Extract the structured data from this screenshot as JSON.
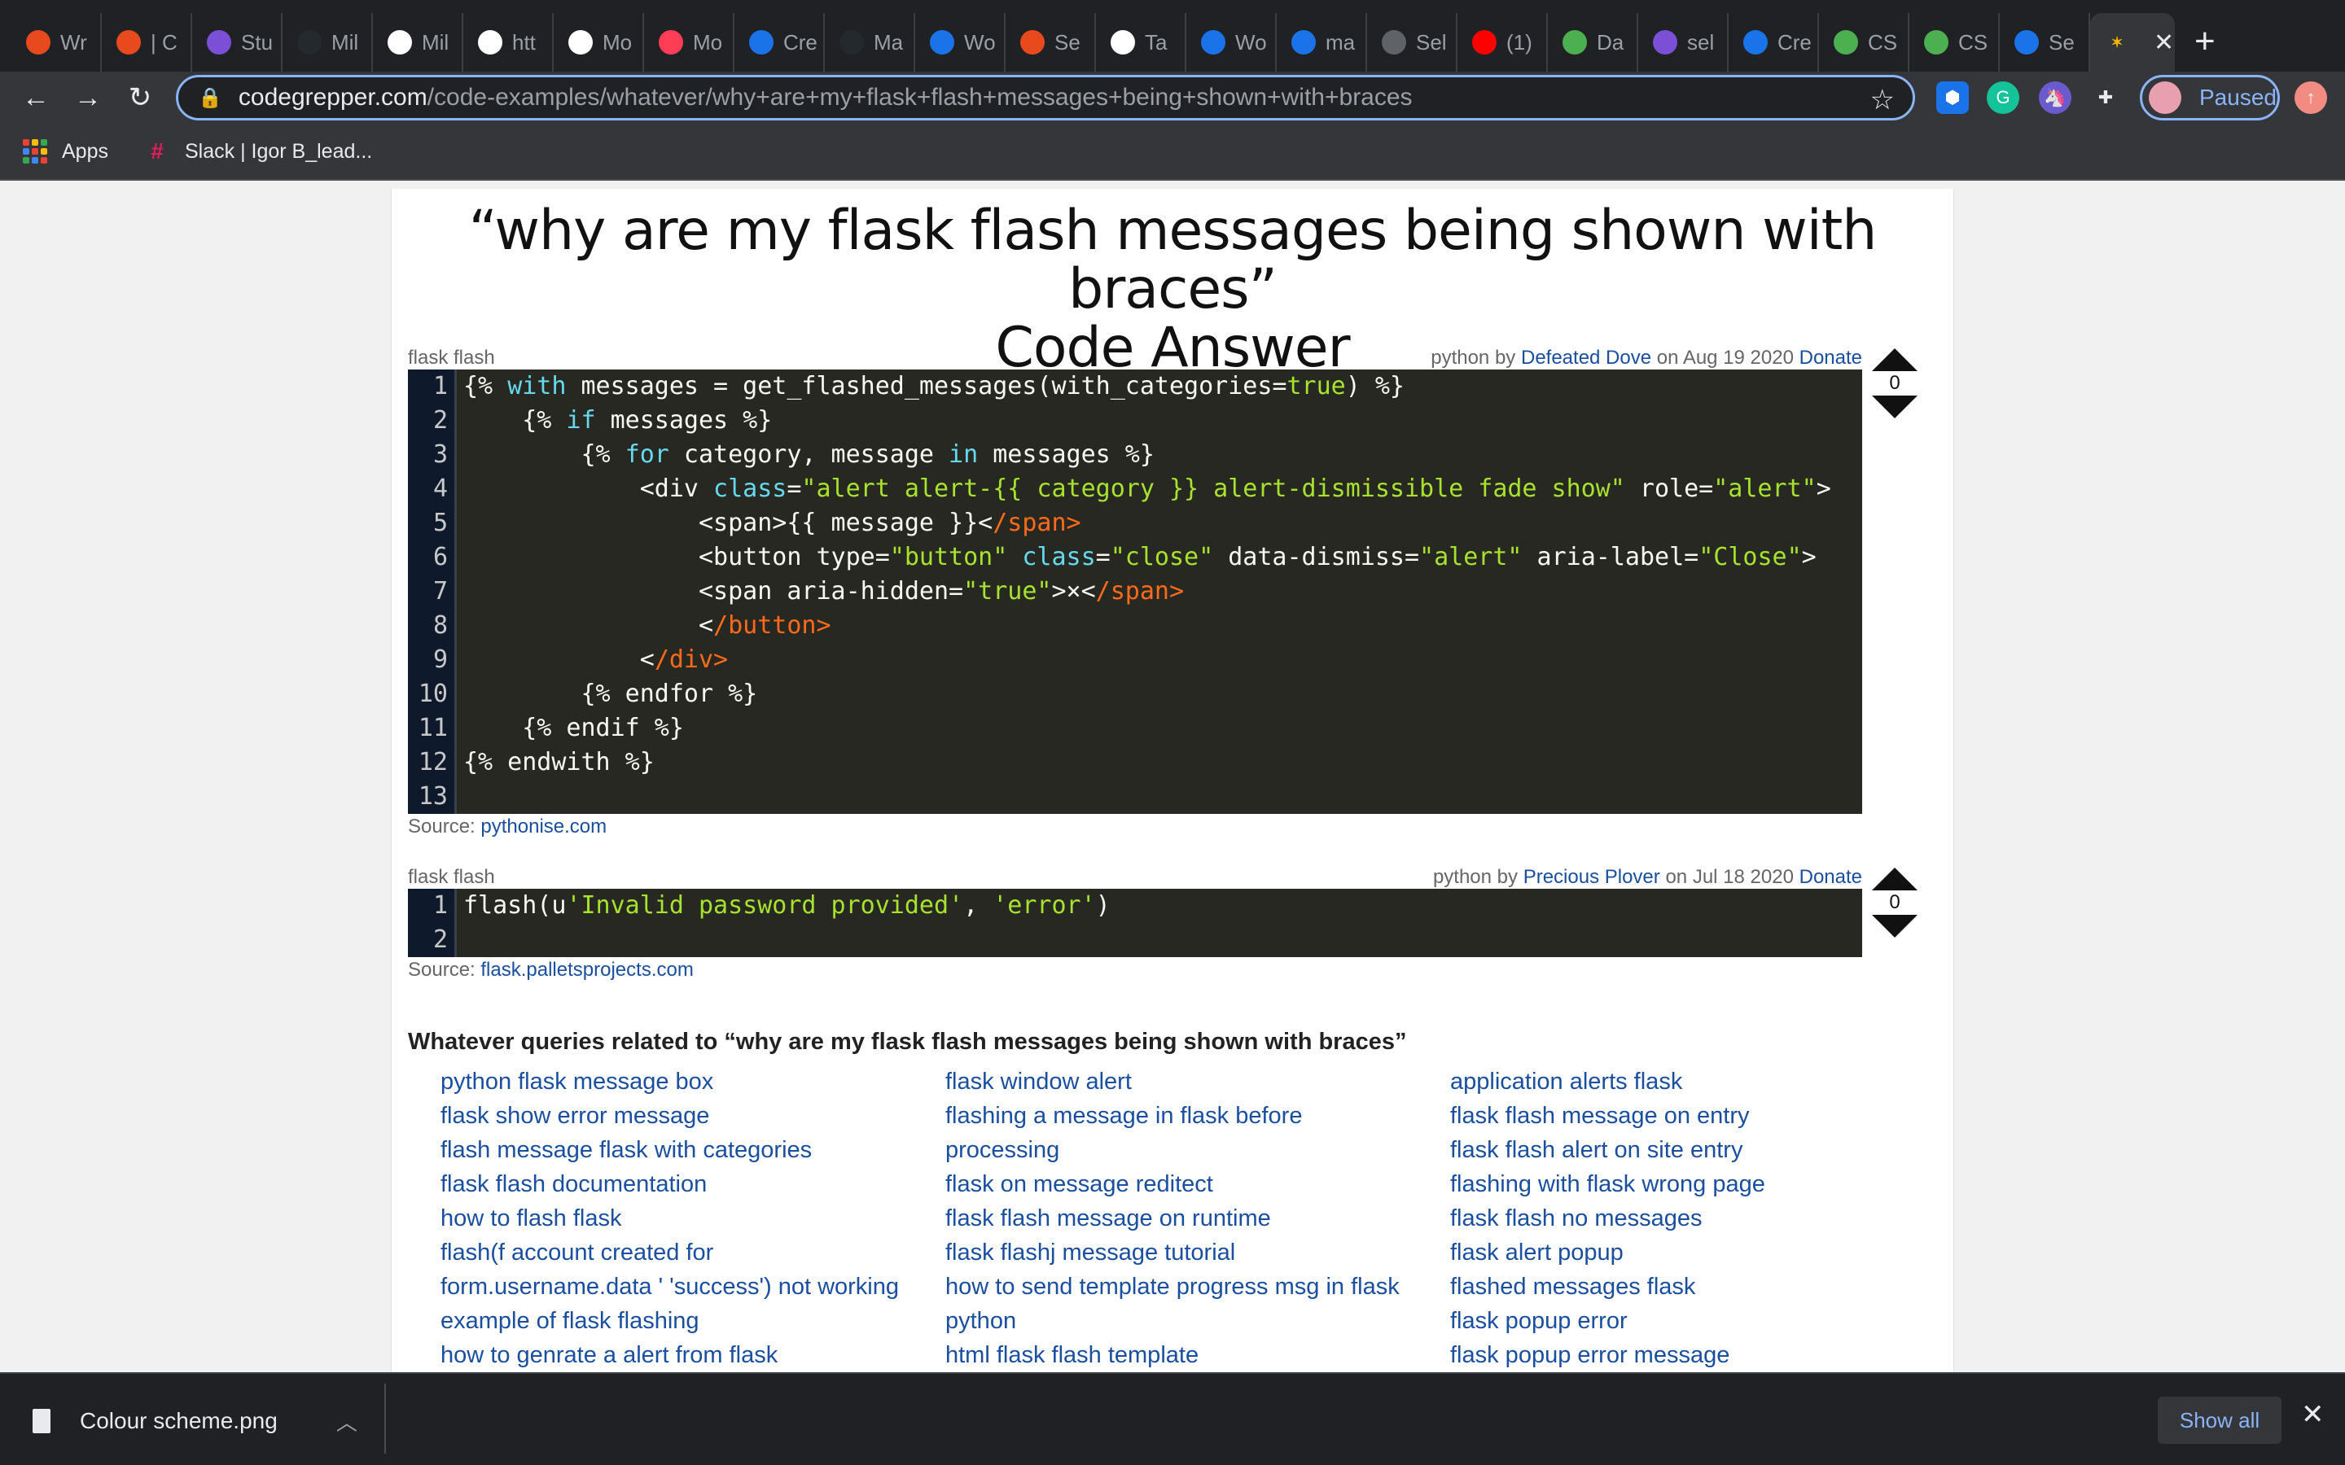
{
  "tabs": [
    {
      "label": "Wr",
      "icon": "opera-icon",
      "color": "#e8491d"
    },
    {
      "label": "| C",
      "icon": "opera-icon",
      "color": "#e8491d"
    },
    {
      "label": "Stu",
      "icon": "list-icon",
      "color": "#7b4fd6"
    },
    {
      "label": "Mil",
      "icon": "github-icon",
      "color": "#24292e"
    },
    {
      "label": "Mil",
      "icon": "github-icon",
      "color": "#ffffff"
    },
    {
      "label": "htt",
      "icon": "globe-icon",
      "color": "#ffffff"
    },
    {
      "label": "Mo",
      "icon": "sheet-icon",
      "color": "#ffffff"
    },
    {
      "label": "Mo",
      "icon": "monday-icon",
      "color": "#ff3d57"
    },
    {
      "label": "Cre",
      "icon": "c-icon",
      "color": "#1a73e8"
    },
    {
      "label": "Ma",
      "icon": "github-icon",
      "color": "#24292e"
    },
    {
      "label": "Wo",
      "icon": "box-icon",
      "color": "#1a73e8"
    },
    {
      "label": "Se",
      "icon": "opera-icon",
      "color": "#e8491d"
    },
    {
      "label": "Ta",
      "icon": "github-icon",
      "color": "#ffffff"
    },
    {
      "label": "Wo",
      "icon": "box-icon",
      "color": "#1a73e8"
    },
    {
      "label": "ma",
      "icon": "box-icon",
      "color": "#1a73e8"
    },
    {
      "label": "Sel",
      "icon": "globe-icon",
      "color": "#5f6368"
    },
    {
      "label": "(1)",
      "icon": "youtube-icon",
      "color": "#ff0000"
    },
    {
      "label": "Da",
      "icon": "leaf-icon",
      "color": "#4caf50"
    },
    {
      "label": "sel",
      "icon": "h-icon",
      "color": "#7b4fd6"
    },
    {
      "label": "Cre",
      "icon": "c-icon",
      "color": "#1a73e8"
    },
    {
      "label": "CS",
      "icon": "w3-icon",
      "color": "#4caf50"
    },
    {
      "label": "CS",
      "icon": "w3-icon",
      "color": "#4caf50"
    },
    {
      "label": "Se",
      "icon": "flag-icon",
      "color": "#1a73e8"
    }
  ],
  "omnibox": {
    "host": "codegrepper.com",
    "path": "/code-examples/whatever/why+are+my+flask+flash+messages+being+shown+with+braces"
  },
  "profile": {
    "label": "Paused"
  },
  "bookmarks": {
    "apps": "Apps",
    "slack": "Slack | Igor B_lead..."
  },
  "page": {
    "title_line1": "“why are my flask flash messages being shown with braces”",
    "title_line2": "Code Answer"
  },
  "answers": [
    {
      "topic": "flask flash",
      "lang": "python",
      "by": "by",
      "author": "Defeated Dove",
      "on": "on",
      "date": "Aug 19 2020",
      "donate": "Donate",
      "votes": "0",
      "source_label": "Source:",
      "source": "pythonise.com"
    },
    {
      "topic": "flask flash",
      "lang": "python",
      "by": "by",
      "author": "Precious Plover",
      "on": "on",
      "date": "Jul 18 2020",
      "donate": "Donate",
      "votes": "0",
      "source_label": "Source:",
      "source": "flask.palletsprojects.com"
    }
  ],
  "related": {
    "heading": "Whatever queries related to “why are my flask flash messages being shown with braces”",
    "col1": [
      "python flask message box",
      "flask show error message",
      "flash message flask with categories",
      "flask flash documentation",
      "how to flash flask",
      "flash(f account created for",
      "form.username.data ' 'success') not working",
      "example of flask flashing",
      "how to genrate a alert from flask"
    ],
    "col2": [
      "flask window alert",
      "flashing a message in flask before",
      "processing",
      "flask on message reditect",
      "flask flash message on runtime",
      "flask flashj message tutorial",
      "how to send template progress msg in flask",
      "python",
      "html flask flash template"
    ],
    "col3": [
      "application alerts flask",
      "flask flash message on entry",
      "flask flash alert on site entry",
      "flashing with flask wrong page",
      "flask flash no messages",
      "flask alert popup",
      "flashed messages flask",
      "flask popup error",
      "flask popup error message"
    ]
  },
  "downloads": {
    "file": "Colour scheme.png",
    "show_all": "Show all"
  }
}
